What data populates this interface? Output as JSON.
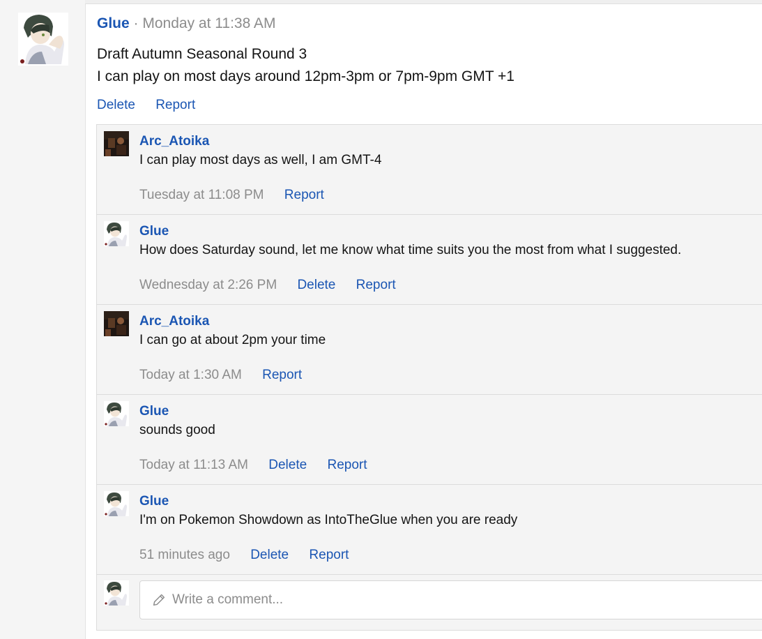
{
  "post": {
    "author": "Glue",
    "separator": "·",
    "time": "Monday at 11:38 AM",
    "body_lines": [
      "Draft Autumn Seasonal Round 3",
      "I can play on most days around 12pm-3pm or 7pm-9pm GMT +1"
    ],
    "actions": {
      "delete": "Delete",
      "report": "Report"
    }
  },
  "comments": [
    {
      "author": "Arc_Atoika",
      "avatar": "dark-scene-avatar",
      "text": "I can play most days as well, I am GMT-4",
      "time": "Tuesday at 11:08 PM",
      "delete": "",
      "report": "Report"
    },
    {
      "author": "Glue",
      "avatar": "anime-character-avatar",
      "text": "How does Saturday sound, let me know what time suits you the most from what I suggested.",
      "time": "Wednesday at 2:26 PM",
      "delete": "Delete",
      "report": "Report"
    },
    {
      "author": "Arc_Atoika",
      "avatar": "dark-scene-avatar",
      "text": "I can go at about 2pm your time",
      "time": "Today at 1:30 AM",
      "delete": "",
      "report": "Report"
    },
    {
      "author": "Glue",
      "avatar": "anime-character-avatar",
      "text": "sounds good",
      "time": "Today at 11:13 AM",
      "delete": "Delete",
      "report": "Report"
    },
    {
      "author": "Glue",
      "avatar": "anime-character-avatar",
      "text": "I'm on Pokemon Showdown as IntoTheGlue when you are ready",
      "time": "51 minutes ago",
      "delete": "Delete",
      "report": "Report"
    }
  ],
  "composer": {
    "placeholder": "Write a comment...",
    "icon": "pencil-icon"
  },
  "colors": {
    "link": "#1b56b3",
    "muted": "#8c8c8c",
    "panel": "#f4f4f4"
  }
}
